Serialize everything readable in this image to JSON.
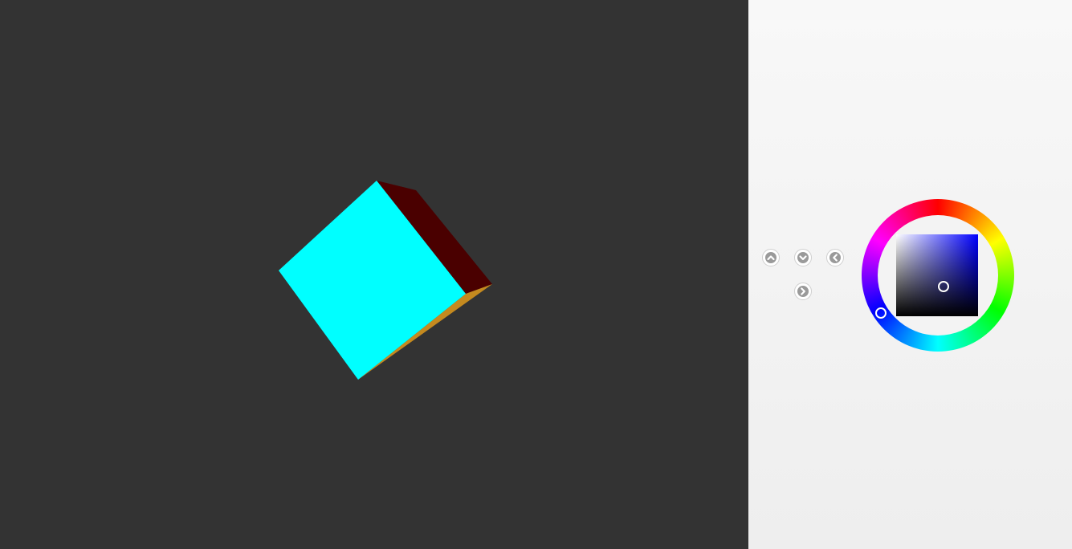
{
  "viewport": {
    "background": "#333333",
    "cube": {
      "front_face_color": "#00ffff",
      "side_face_color": "#4a0000",
      "bottom_face_color": "#c58a1f"
    }
  },
  "controls": {
    "buttons": [
      {
        "name": "rotate-up-button",
        "icon": "chevron-up-icon"
      },
      {
        "name": "rotate-down-button",
        "icon": "chevron-down-icon"
      },
      {
        "name": "rotate-left-button",
        "icon": "chevron-left-icon"
      },
      {
        "name": "rotate-right-button",
        "icon": "chevron-right-icon"
      }
    ]
  },
  "color_picker": {
    "selected_hue_color": "#0000ff",
    "selected_color": "#0b0b2a"
  }
}
